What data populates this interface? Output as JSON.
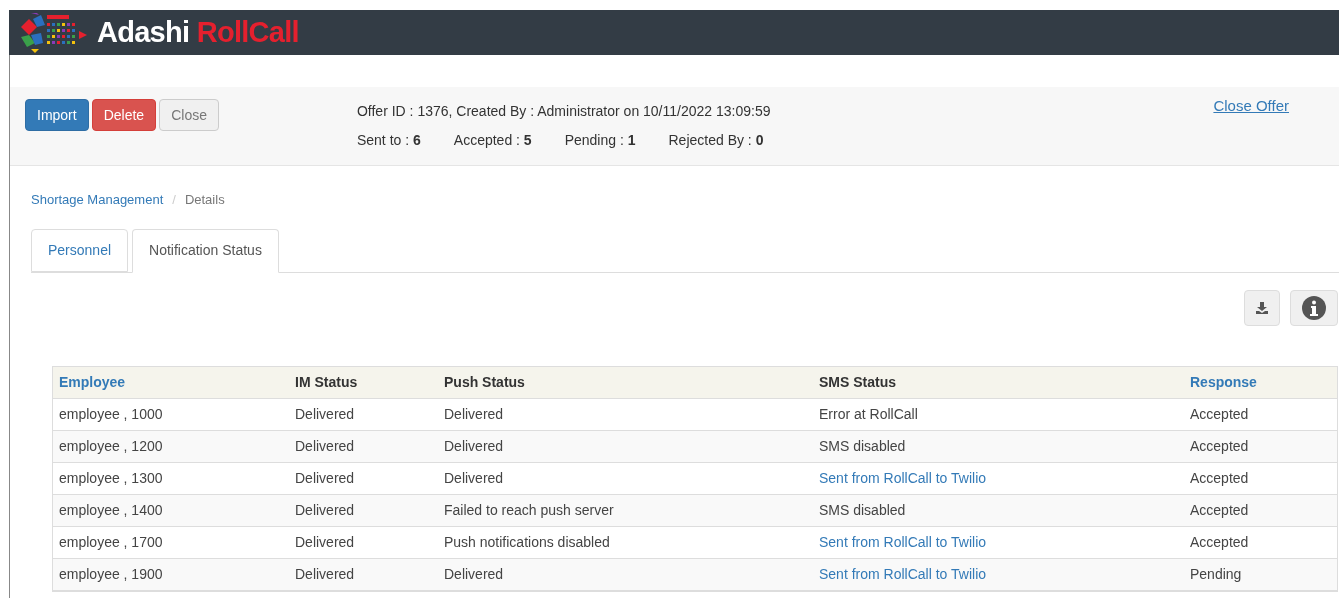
{
  "logo": {
    "word_1": "Adashi",
    "word_2": "RollCall"
  },
  "toolbar": {
    "buttons": [
      {
        "label": "Import",
        "kind": "primary"
      },
      {
        "label": "Delete",
        "kind": "danger"
      },
      {
        "label": "Close",
        "kind": "default"
      }
    ],
    "offer_info": "Offer ID : 1376, Created By : Administrator on 10/11/2022 13:09:59",
    "stats": [
      "Sent to : **6**",
      "Accepted : **5**",
      "Pending : **1**",
      "Rejected By : **0**"
    ],
    "close_offer_link": "Close Offer"
  },
  "breadcrumb_separator": "/",
  "breadcrumb": [
    {
      "label": "Shortage Management",
      "kind": "link"
    },
    {
      "label": "Details",
      "kind": "current"
    }
  ],
  "tabs": [
    {
      "label": "Personnel",
      "selected": false
    },
    {
      "label": "Notification Status",
      "selected": true
    }
  ],
  "table": {
    "columns": [
      {
        "label": "Employee",
        "sortable": true
      },
      {
        "label": "IM Status",
        "sortable": false
      },
      {
        "label": "Push Status",
        "sortable": false
      },
      {
        "label": "SMS Status",
        "sortable": false
      },
      {
        "label": "Response",
        "sortable": true
      }
    ],
    "rows": [
      [
        {
          "text": "employee , 1000",
          "kind": "text"
        },
        {
          "text": "Delivered",
          "kind": "text"
        },
        {
          "text": "Delivered",
          "kind": "text"
        },
        {
          "text": "Error at RollCall",
          "kind": "text"
        },
        {
          "text": "Accepted",
          "kind": "text"
        }
      ],
      [
        {
          "text": "employee , 1200",
          "kind": "text"
        },
        {
          "text": "Delivered",
          "kind": "text"
        },
        {
          "text": "Delivered",
          "kind": "text"
        },
        {
          "text": "SMS disabled",
          "kind": "text"
        },
        {
          "text": "Accepted",
          "kind": "text"
        }
      ],
      [
        {
          "text": "employee , 1300",
          "kind": "text"
        },
        {
          "text": "Delivered",
          "kind": "text"
        },
        {
          "text": "Delivered",
          "kind": "text"
        },
        {
          "text": "Sent from RollCall to Twilio",
          "kind": "link"
        },
        {
          "text": "Accepted",
          "kind": "text"
        }
      ],
      [
        {
          "text": "employee , 1400",
          "kind": "text"
        },
        {
          "text": "Delivered",
          "kind": "text"
        },
        {
          "text": "Failed to reach push server",
          "kind": "text"
        },
        {
          "text": "SMS disabled",
          "kind": "text"
        },
        {
          "text": "Accepted",
          "kind": "text"
        }
      ],
      [
        {
          "text": "employee , 1700",
          "kind": "text"
        },
        {
          "text": "Delivered",
          "kind": "text"
        },
        {
          "text": "Push notifications disabled",
          "kind": "text"
        },
        {
          "text": "Sent from RollCall to Twilio",
          "kind": "link"
        },
        {
          "text": "Accepted",
          "kind": "text"
        }
      ],
      [
        {
          "text": "employee , 1900",
          "kind": "text"
        },
        {
          "text": "Delivered",
          "kind": "text"
        },
        {
          "text": "Delivered",
          "kind": "text"
        },
        {
          "text": "Sent from RollCall to Twilio",
          "kind": "link"
        },
        {
          "text": "Pending",
          "kind": "text"
        }
      ]
    ]
  }
}
